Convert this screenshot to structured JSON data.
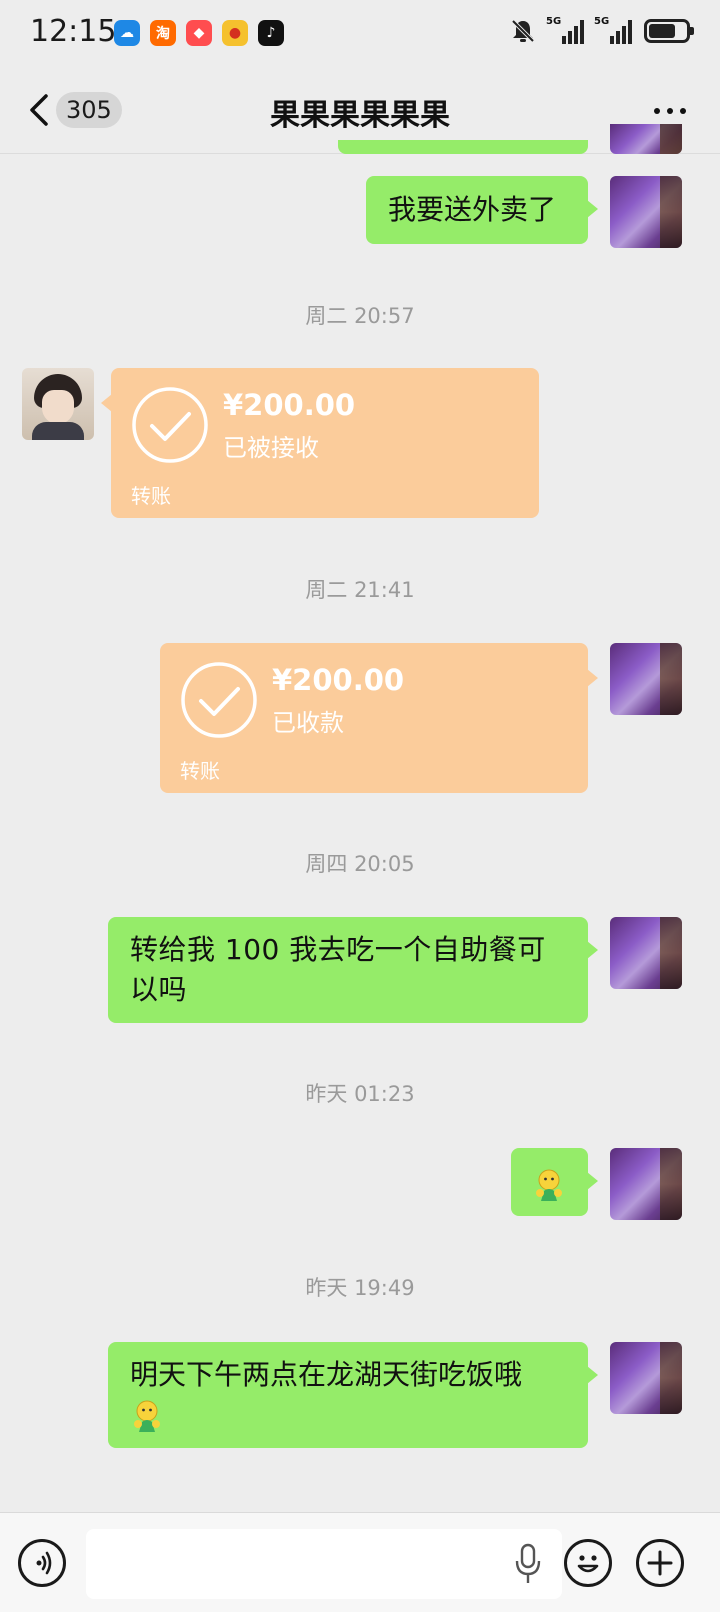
{
  "status_bar": {
    "time": "12:15",
    "apps": [
      {
        "icon": "weather-icon",
        "color": "#1e88e5",
        "glyph": "☁"
      },
      {
        "icon": "taobao-icon",
        "color": "#ff6a00",
        "glyph": "淘"
      },
      {
        "icon": "shopping-bag-icon",
        "color": "#ff4d4f",
        "glyph": "◆"
      },
      {
        "icon": "weibo-icon",
        "color": "#f5c12e",
        "glyph": "●"
      },
      {
        "icon": "tiktok-icon",
        "color": "#111111",
        "glyph": "♪"
      }
    ],
    "network_1": "5G",
    "network_2": "5G"
  },
  "header": {
    "unread_count": "305",
    "title": "果果果果果果"
  },
  "messages": {
    "m1_text": "我要送外卖了",
    "time1": "周二 20:57",
    "transfer1": {
      "amount": "¥200.00",
      "status": "已被接收",
      "label": "转账"
    },
    "time2": "周二 21:41",
    "transfer2": {
      "amount": "¥200.00",
      "status": "已收款",
      "label": "转账"
    },
    "time3": "周四 20:05",
    "m2_text": "转给我 100 我去吃一个自助餐可以吗",
    "time4": "昨天 01:23",
    "time5": "昨天 19:49",
    "m4_text": "明天下午两点在龙湖天街吃饭哦"
  },
  "colors": {
    "bubble_green": "#95ec69",
    "transfer_orange": "#fbcc9b",
    "background": "#ededed"
  }
}
